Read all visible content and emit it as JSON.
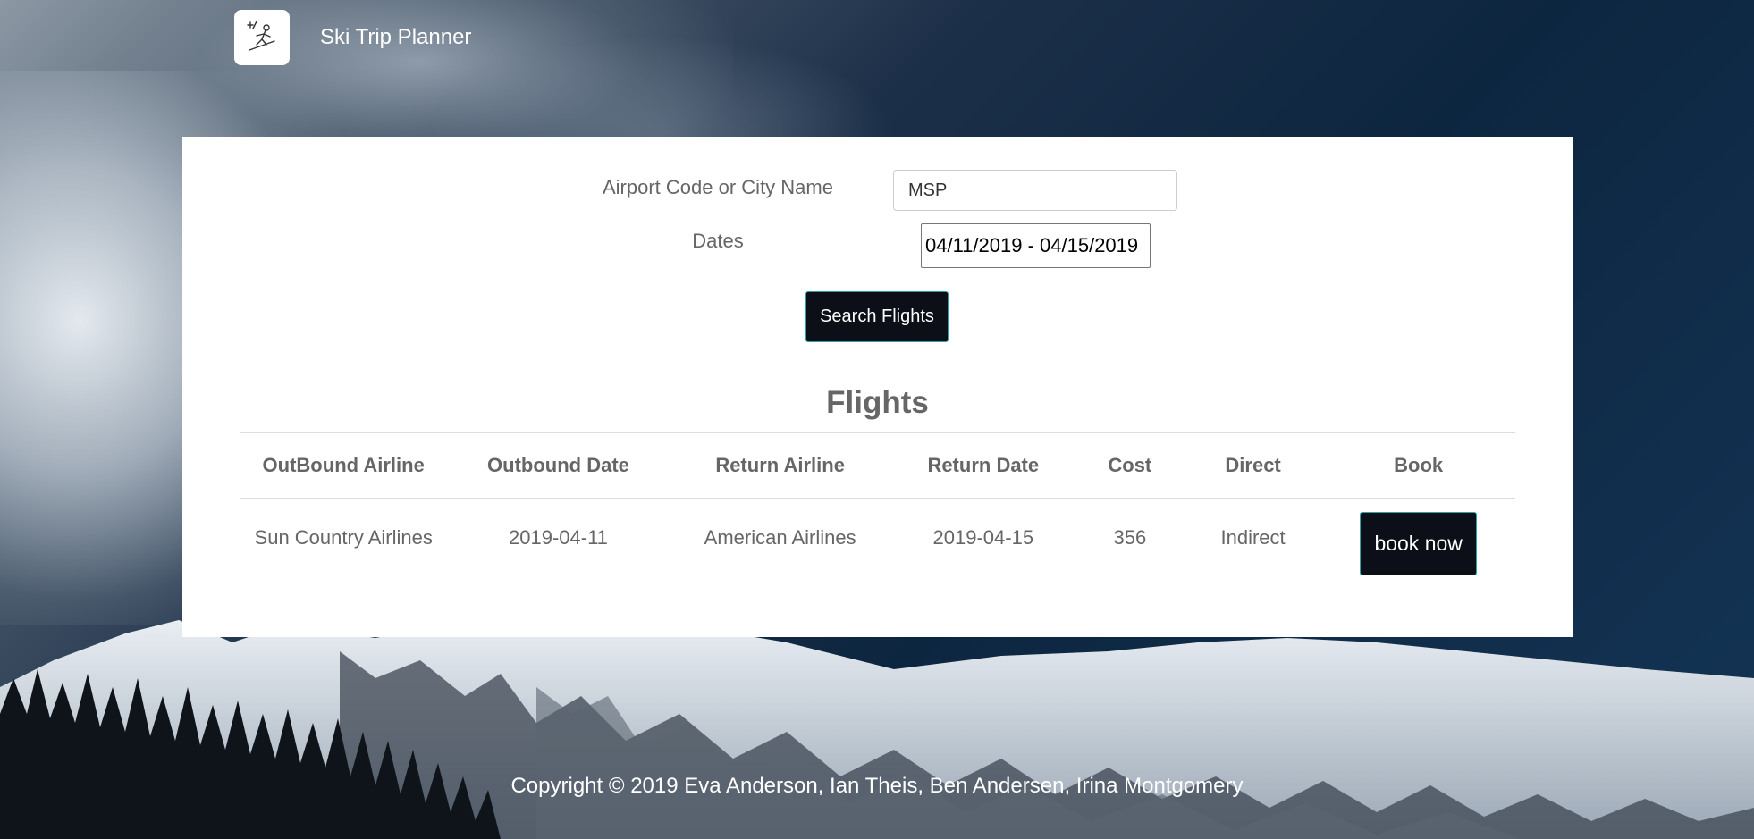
{
  "app": {
    "title": "Ski Trip Planner",
    "logo_icon": "skier-icon"
  },
  "search": {
    "airport_label": "Airport Code or City Name",
    "airport_value": "MSP",
    "dates_label": "Dates",
    "dates_value": "04/11/2019 - 04/15/2019",
    "button_label": "Search Flights"
  },
  "flights": {
    "title": "Flights",
    "columns": [
      "OutBound Airline",
      "Outbound Date",
      "Return Airline",
      "Return Date",
      "Cost",
      "Direct",
      "Book"
    ],
    "rows": [
      {
        "outbound_airline": "Sun Country Airlines",
        "outbound_date": "2019-04-11",
        "return_airline": "American Airlines",
        "return_date": "2019-04-15",
        "cost": "356",
        "direct": "Indirect",
        "book_label": "book now"
      }
    ]
  },
  "footer": {
    "copyright": "Copyright © 2019 Eva Anderson, Ian Theis, Ben Andersen, Irina Montgomery"
  },
  "colors": {
    "button_bg": "#0c0f17",
    "button_border": "#2aa3a8",
    "text_gray": "#666666"
  }
}
